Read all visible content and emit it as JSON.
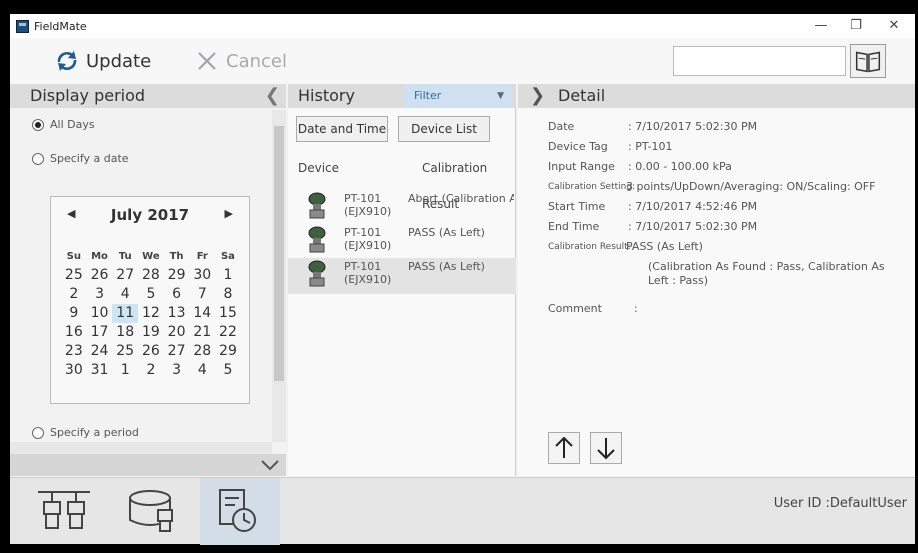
{
  "window": {
    "title": "FieldMate"
  },
  "toolbar": {
    "update_label": "Update",
    "cancel_label": "Cancel",
    "search_value": ""
  },
  "display_period": {
    "title": "Display period",
    "all_days": "All Days",
    "specify_date": "Specify a date",
    "specify_period": "Specify a period",
    "selected": "All Days"
  },
  "calendar": {
    "month_label": "July 2017",
    "weekdays": [
      "Su",
      "Mo",
      "Tu",
      "We",
      "Th",
      "Fr",
      "Sa"
    ],
    "weeks": [
      [
        "25",
        "26",
        "27",
        "28",
        "29",
        "30",
        "1"
      ],
      [
        "2",
        "3",
        "4",
        "5",
        "6",
        "7",
        "8"
      ],
      [
        "9",
        "10",
        "11",
        "12",
        "13",
        "14",
        "15"
      ],
      [
        "16",
        "17",
        "18",
        "19",
        "20",
        "21",
        "22"
      ],
      [
        "23",
        "24",
        "25",
        "26",
        "27",
        "28",
        "29"
      ],
      [
        "30",
        "31",
        "1",
        "2",
        "3",
        "4",
        "5"
      ]
    ],
    "selected_day": "11"
  },
  "history": {
    "title": "History",
    "filter_label": "Filter",
    "sort_date_label": "Date and Time",
    "sort_device_label": "Device List",
    "col_device": "Device",
    "col_result": "Calibration Result",
    "rows": [
      {
        "tag": "PT-101",
        "model": "(EJX910)",
        "result": "Abort (Calibration A"
      },
      {
        "tag": "PT-101",
        "model": "(EJX910)",
        "result": "PASS (As Left)"
      },
      {
        "tag": "PT-101",
        "model": "(EJX910)",
        "result": "PASS (As Left)"
      }
    ]
  },
  "detail": {
    "title": "Detail",
    "date_label": "Date",
    "date_value": ": 7/10/2017 5:02:30 PM",
    "tag_label": "Device Tag",
    "tag_value": ": PT-101",
    "range_label": "Input Range",
    "range_value": ": 0.00 - 100.00 kPa",
    "setting_label": "Calibration Setting:",
    "setting_value": "3 points/UpDown/Averaging: ON/Scaling: OFF",
    "start_label": "Start Time",
    "start_value": ": 7/10/2017 4:52:46 PM",
    "end_label": "End Time",
    "end_value": ": 7/10/2017 5:02:30 PM",
    "result_label": "Calibration Result:",
    "result_value": "PASS (As Left)",
    "result_detail_1": "(Calibration As Found : Pass, Calibration As",
    "result_detail_2": "Left : Pass)",
    "comment_label": "Comment",
    "comment_value": ":"
  },
  "status": {
    "user_id": "User ID :DefaultUser"
  }
}
